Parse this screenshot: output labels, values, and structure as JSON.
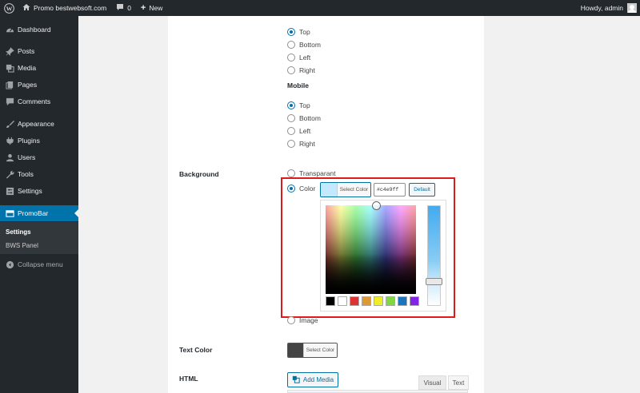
{
  "adminbar": {
    "site_name": "Promo bestwebsoft.com",
    "comments_count": "0",
    "new_label": "New",
    "howdy": "Howdy, admin"
  },
  "sidebar": {
    "items": [
      {
        "label": "Dashboard",
        "icon": "dashboard-icon"
      },
      {
        "label": "Posts",
        "icon": "pin-icon"
      },
      {
        "label": "Media",
        "icon": "media-icon"
      },
      {
        "label": "Pages",
        "icon": "pages-icon"
      },
      {
        "label": "Comments",
        "icon": "comment-icon"
      },
      {
        "label": "Appearance",
        "icon": "brush-icon"
      },
      {
        "label": "Plugins",
        "icon": "plug-icon"
      },
      {
        "label": "Users",
        "icon": "user-icon"
      },
      {
        "label": "Tools",
        "icon": "wrench-icon"
      },
      {
        "label": "Settings",
        "icon": "settings-icon"
      },
      {
        "label": "PromoBar",
        "icon": "promobar-icon"
      }
    ],
    "submenu": [
      "Settings",
      "BWS Panel"
    ],
    "collapse": "Collapse menu"
  },
  "position": {
    "desktop_options": [
      "Top",
      "Bottom",
      "Left",
      "Right"
    ],
    "mobile_label": "Mobile",
    "mobile_options": [
      "Top",
      "Bottom",
      "Left",
      "Right"
    ]
  },
  "background": {
    "label": "Background",
    "opt_transparent": "Transparant",
    "opt_color": "Color",
    "opt_image": "Image",
    "select_color": "Select Color",
    "hex_value": "#c4e9ff",
    "default_label": "Default",
    "swatch_color": "#c4e9ff",
    "palette": [
      "#000000",
      "#ffffff",
      "#dd3333",
      "#dd9933",
      "#eeee22",
      "#81d742",
      "#1e73be",
      "#8224e3"
    ]
  },
  "text_color": {
    "label": "Text Color",
    "select_color": "Select Color",
    "swatch_color": "#444444"
  },
  "html": {
    "label": "HTML",
    "add_media": "Add Media",
    "tab_visual": "Visual",
    "tab_text": "Text"
  }
}
